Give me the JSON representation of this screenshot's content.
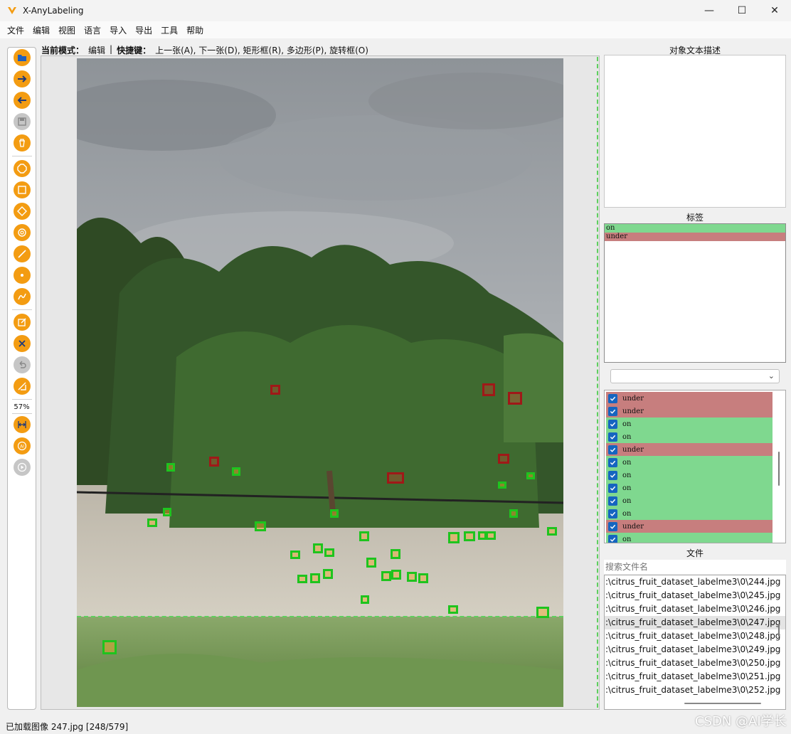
{
  "window": {
    "title": "X-AnyLabeling",
    "minimize": "—",
    "maximize": "☐",
    "close": "✕"
  },
  "menu": [
    "文件",
    "编辑",
    "视图",
    "语言",
    "导入",
    "导出",
    "工具",
    "帮助"
  ],
  "mode": {
    "label": "当前模式：",
    "value": "编辑",
    "sep": "|",
    "shortcut_label": "快捷键：",
    "shortcuts": "上一张(A), 下一张(D), 矩形框(R), 多边形(P), 旋转框(O)"
  },
  "toolbar": {
    "zoom": "57%"
  },
  "panels": {
    "description_title": "对象文本描述",
    "labels_title": "标签",
    "files_title": "文件",
    "search_placeholder": "搜索文件名"
  },
  "colors": {
    "on": "#7fd88f",
    "under": "#c77e7e",
    "accent": "#f39c12",
    "check": "#1565c0"
  },
  "labels": [
    {
      "name": "on",
      "kind": "on"
    },
    {
      "name": "under",
      "kind": "under"
    }
  ],
  "shapes": [
    {
      "label": "under",
      "kind": "under"
    },
    {
      "label": "under",
      "kind": "under"
    },
    {
      "label": "on",
      "kind": "on"
    },
    {
      "label": "on",
      "kind": "on"
    },
    {
      "label": "under",
      "kind": "under"
    },
    {
      "label": "on",
      "kind": "on"
    },
    {
      "label": "on",
      "kind": "on"
    },
    {
      "label": "on",
      "kind": "on"
    },
    {
      "label": "on",
      "kind": "on"
    },
    {
      "label": "on",
      "kind": "on"
    },
    {
      "label": "under",
      "kind": "under"
    },
    {
      "label": "on",
      "kind": "on"
    }
  ],
  "files": [
    ":\\citrus_fruit_dataset_labelme3\\0\\244.jpg",
    ":\\citrus_fruit_dataset_labelme3\\0\\245.jpg",
    ":\\citrus_fruit_dataset_labelme3\\0\\246.jpg",
    ":\\citrus_fruit_dataset_labelme3\\0\\247.jpg",
    ":\\citrus_fruit_dataset_labelme3\\0\\248.jpg",
    ":\\citrus_fruit_dataset_labelme3\\0\\249.jpg",
    ":\\citrus_fruit_dataset_labelme3\\0\\250.jpg",
    ":\\citrus_fruit_dataset_labelme3\\0\\251.jpg",
    ":\\citrus_fruit_dataset_labelme3\\0\\252.jpg"
  ],
  "selected_file": 3,
  "status": "已加载图像 247.jpg [248/579]",
  "watermark": "CSDN @AI学长"
}
